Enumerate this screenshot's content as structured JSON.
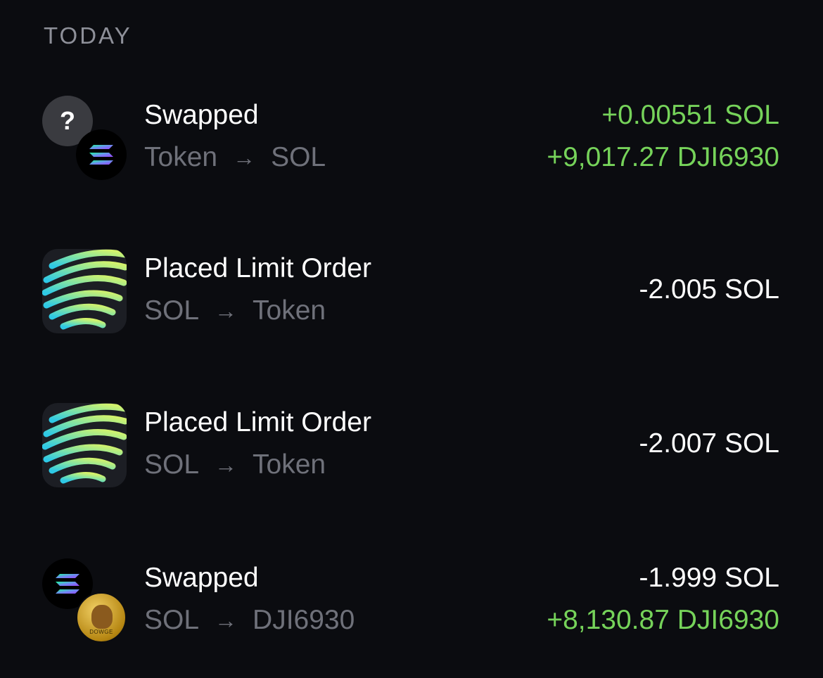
{
  "section": {
    "title": "TODAY"
  },
  "colors": {
    "positive": "#76d35a",
    "neutral": "#ffffff",
    "muted": "#6f717a"
  },
  "transactions": [
    {
      "title": "Swapped",
      "from": "Token",
      "to": "SOL",
      "icon": "unknown-token-with-sol-icon",
      "unknown_glyph": "?",
      "amounts": [
        "+0.00551 SOL",
        "+9,017.27 DJI6930"
      ]
    },
    {
      "title": "Placed Limit Order",
      "from": "SOL",
      "to": "Token",
      "icon": "limit-order-app-icon",
      "amounts": [
        "-2.005 SOL"
      ]
    },
    {
      "title": "Placed Limit Order",
      "from": "SOL",
      "to": "Token",
      "icon": "limit-order-app-icon",
      "amounts": [
        "-2.007 SOL"
      ]
    },
    {
      "title": "Swapped",
      "from": "SOL",
      "to": "DJI6930",
      "icon": "sol-with-dowge-coin-icon",
      "coin_label": "DOWGE",
      "amounts": [
        "-1.999 SOL",
        "+8,130.87 DJI6930"
      ]
    }
  ],
  "arrow_glyph": "→"
}
